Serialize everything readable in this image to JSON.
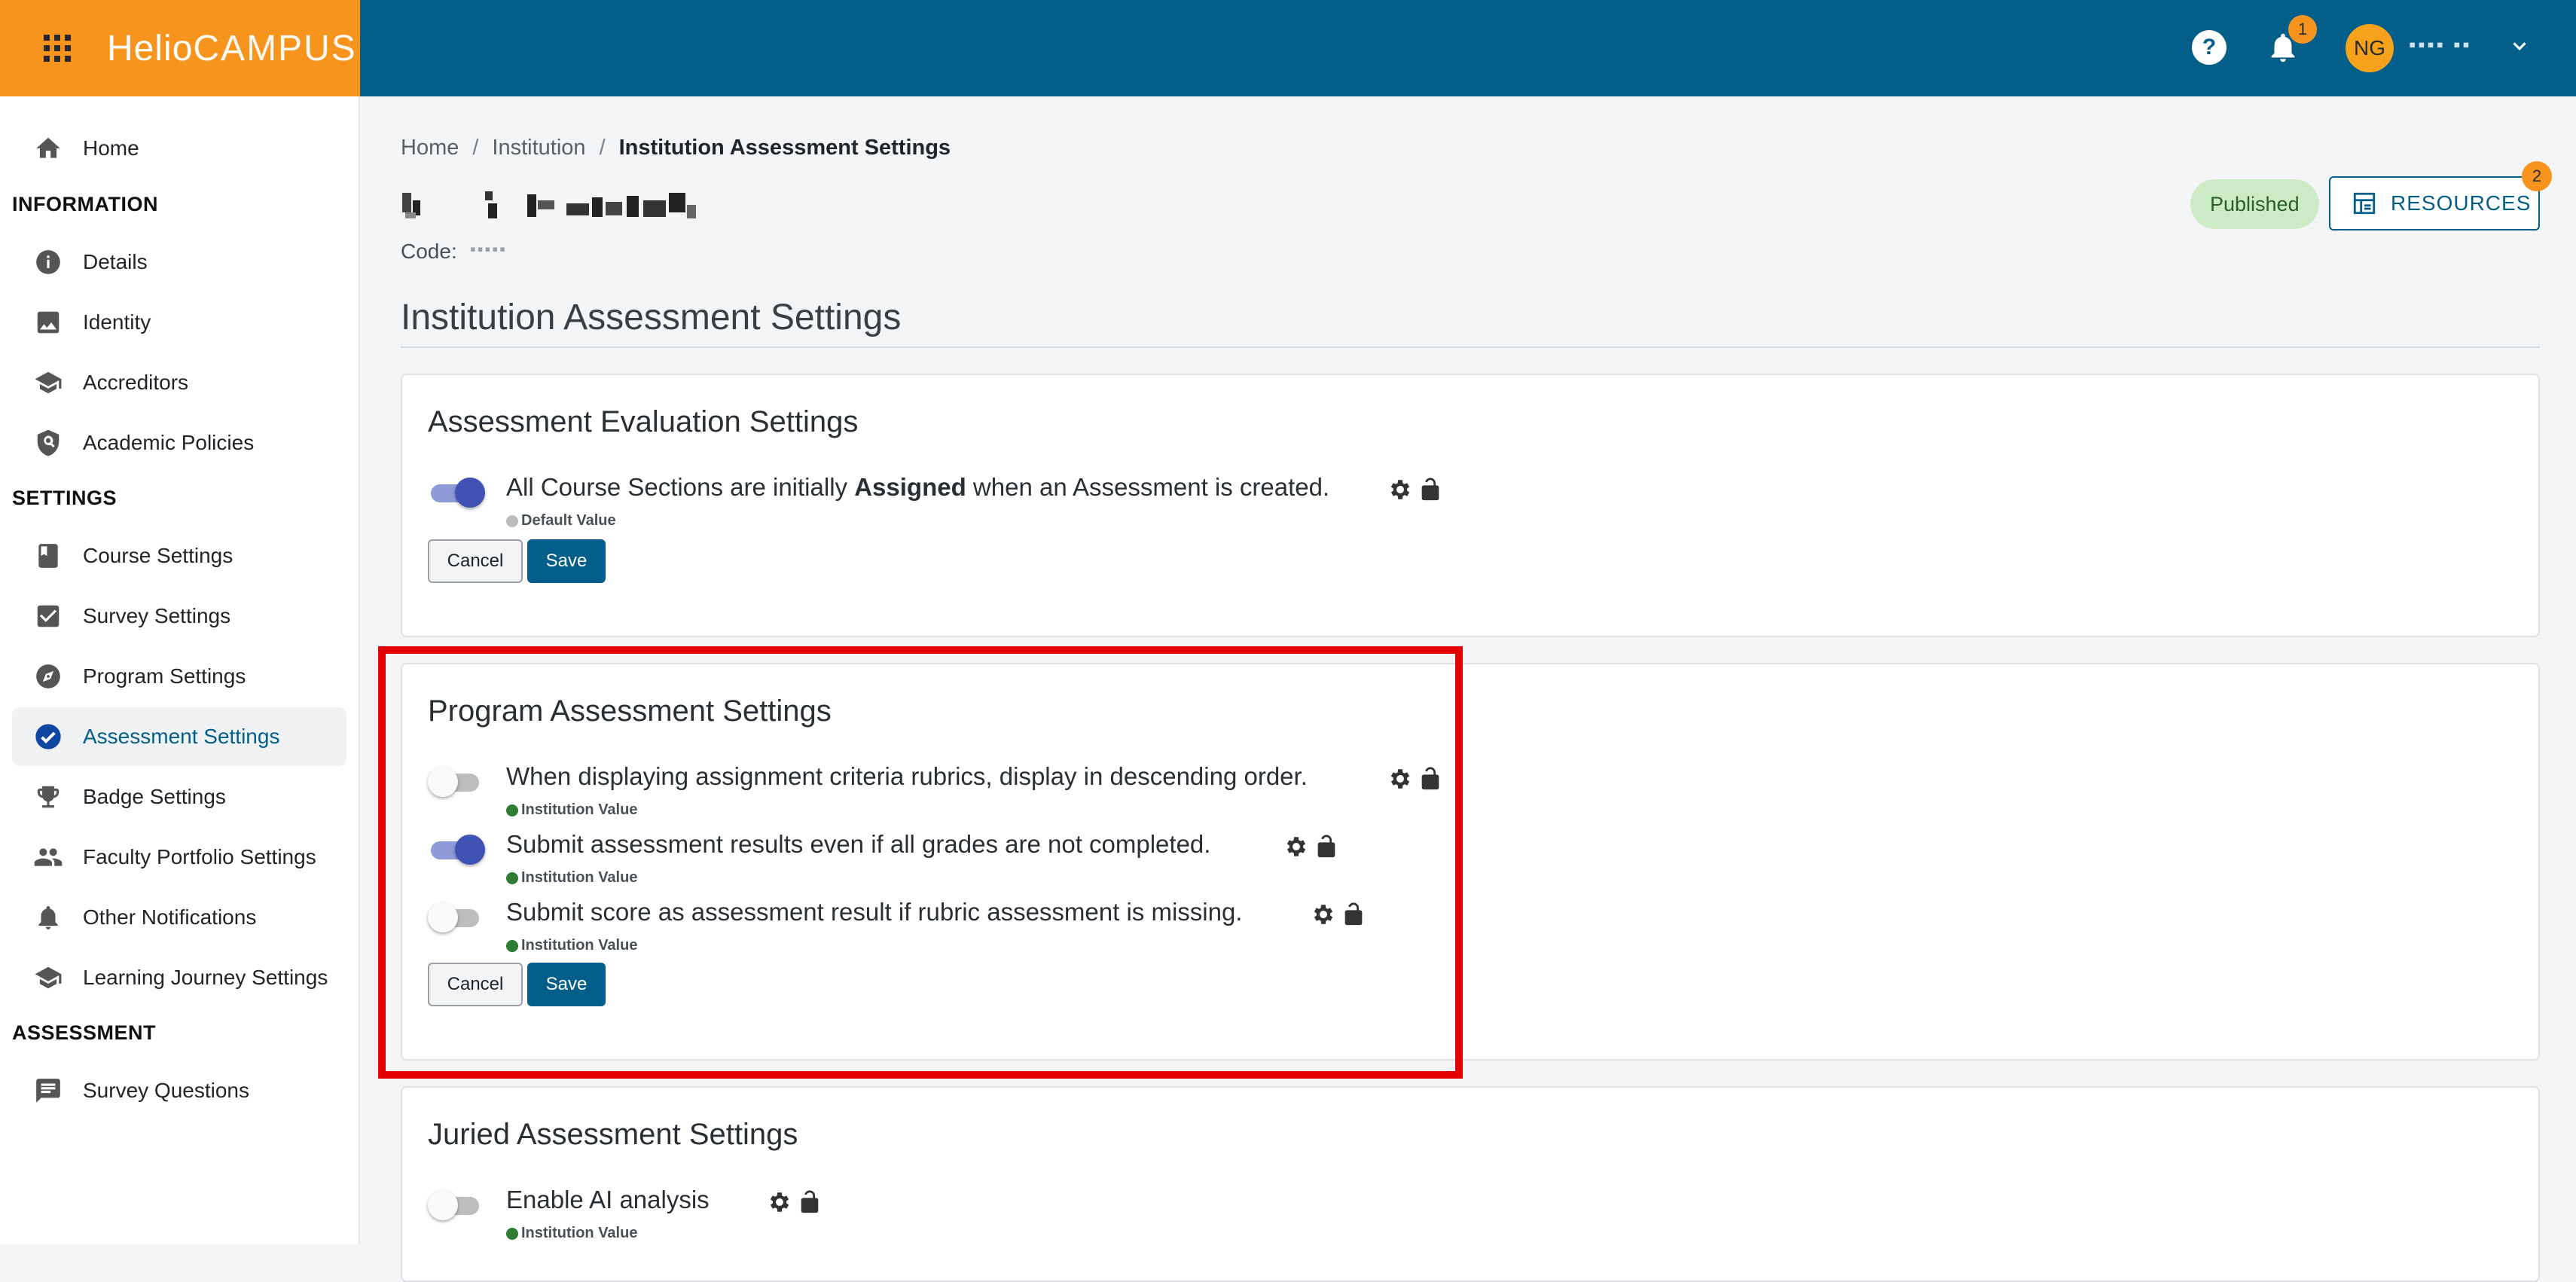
{
  "header": {
    "brand_strong": "Helio",
    "brand_light": "CAMPUS",
    "notification_count": "1",
    "user_initials": "NG",
    "user_name": "▪▪▪▪ ▪▪"
  },
  "sidebar": {
    "home": "Home",
    "sections": {
      "information": "INFORMATION",
      "settings": "SETTINGS",
      "assessment": "ASSESSMENT"
    },
    "information_items": [
      "Details",
      "Identity",
      "Accreditors",
      "Academic Policies"
    ],
    "settings_items": [
      "Course Settings",
      "Survey Settings",
      "Program Settings",
      "Assessment Settings",
      "Badge Settings",
      "Faculty Portfolio Settings",
      "Other Notifications",
      "Learning Journey Settings"
    ],
    "assessment_items": [
      "Survey Questions"
    ]
  },
  "breadcrumb": [
    "Home",
    "Institution",
    "Institution Assessment Settings"
  ],
  "institution": {
    "code_label": "Code:",
    "code_value": "▪▪▪▪▪"
  },
  "status": "Published",
  "resources": {
    "label": "RESOURCES",
    "badge": "2"
  },
  "page_title": "Institution Assessment Settings",
  "cards": {
    "evaluation": {
      "title": "Assessment Evaluation Settings",
      "setting1": {
        "text_pre": "All Course Sections are initially ",
        "text_bold": "Assigned",
        "text_post": " when an Assessment is created.",
        "source": "Default Value",
        "enabled": true
      },
      "cancel": "Cancel",
      "save": "Save"
    },
    "program": {
      "title": "Program Assessment Settings",
      "settings": [
        {
          "text": "When displaying assignment criteria rubrics, display in descending order.",
          "source": "Institution Value",
          "enabled": false
        },
        {
          "text": "Submit assessment results even if all grades are not completed.",
          "source": "Institution Value",
          "enabled": true
        },
        {
          "text": "Submit score as assessment result if rubric assessment is missing.",
          "source": "Institution Value",
          "enabled": false
        }
      ],
      "cancel": "Cancel",
      "save": "Save"
    },
    "juried": {
      "title": "Juried Assessment Settings",
      "setting1": {
        "text": "Enable AI analysis",
        "source": "Institution Value",
        "enabled": false
      }
    }
  },
  "colors": {
    "header": "#035e8a",
    "brand": "#f7941d",
    "toggle_on": "#3f51b5",
    "default_dot": "#bdbdbd",
    "institution_dot": "#2e7d32",
    "highlight": "#e50000"
  }
}
